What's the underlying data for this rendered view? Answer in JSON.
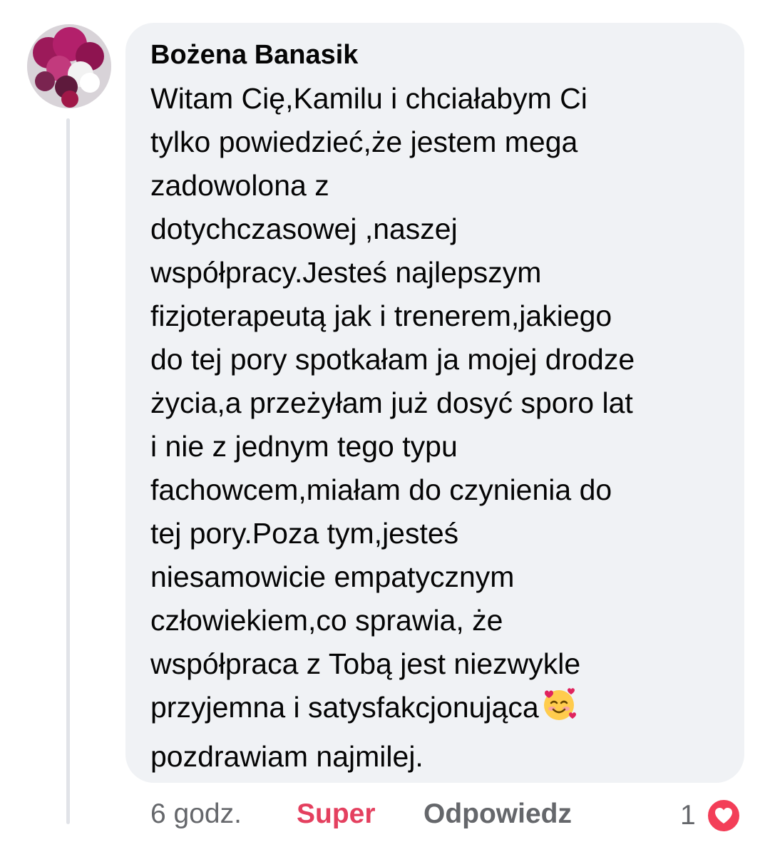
{
  "comment": {
    "author": "Bożena Banasik",
    "text_lines": [
      "Witam Cię,Kamilu i chciałabym Ci",
      "tylko powiedzieć,że jestem mega",
      "zadowolona z",
      "dotychczasowej ,naszej",
      "współpracy.Jesteś najlepszym",
      "fizjoterapeutą jak i trenerem,jakiego",
      "do tej pory spotkałam ja mojej drodze",
      "życia,a przeżyłam już dosyć sporo lat",
      "i nie z jednym tego typu",
      "fachowcem,miałam do czynienia do",
      "tej pory.Poza tym,jesteś",
      "niesamowicie empatycznym",
      "człowiekiem,co sprawia, że",
      "współpraca z Tobą jest niezwykle",
      "przyjemna i satysfakcjonująca",
      "pozdrawiam najmilej."
    ],
    "emoji": "smiling-face-with-hearts"
  },
  "actions": {
    "time": "6 godz.",
    "like_label": "Super",
    "reply_label": "Odpowiedz",
    "reaction_count": "1",
    "reaction_icon": "heart-icon"
  },
  "colors": {
    "bubble": "#f0f2f5",
    "text": "#050505",
    "muted": "#65676b",
    "love_accent": "#e4405f"
  }
}
